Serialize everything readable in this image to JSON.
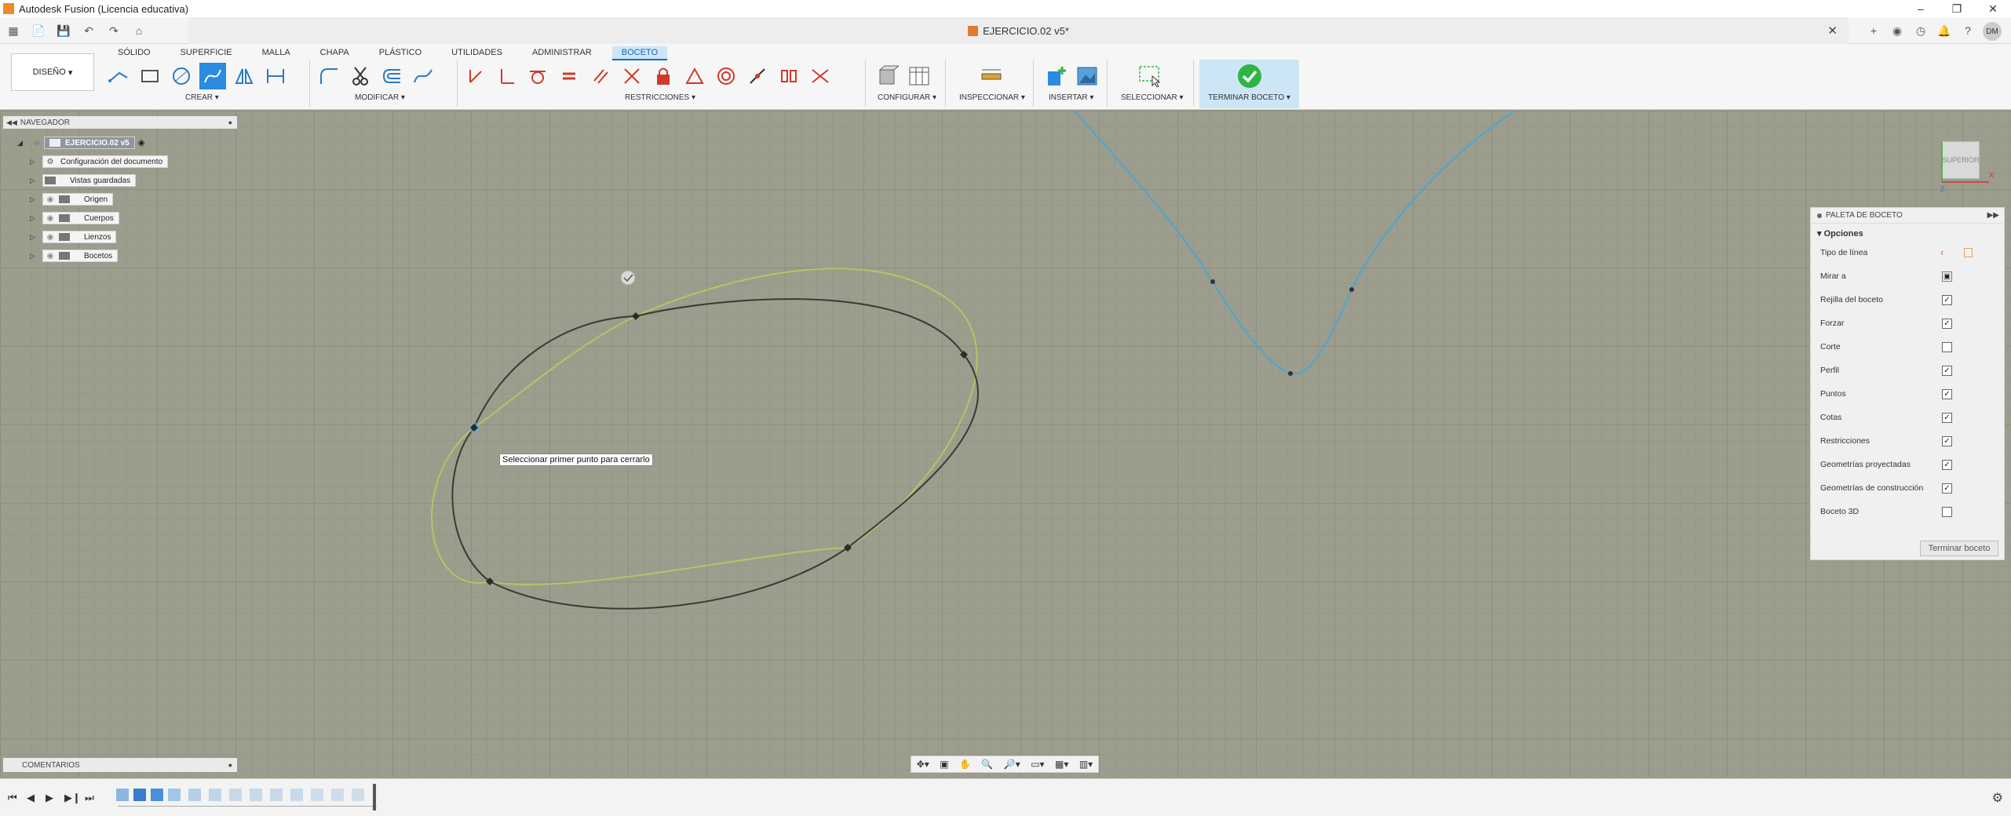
{
  "titlebar": {
    "title": "Autodesk Fusion (Licencia educativa)"
  },
  "document": {
    "name": "EJERCICIO.02 v5*"
  },
  "user": {
    "initials": "DM"
  },
  "workspace": {
    "label": "DISEÑO"
  },
  "tabs": [
    "SÓLIDO",
    "SUPERFICIE",
    "MALLA",
    "CHAPA",
    "PLÁSTICO",
    "UTILIDADES",
    "ADMINISTRAR",
    "BOCETO"
  ],
  "active_tab": "BOCETO",
  "groups": {
    "crear": "CREAR",
    "modificar": "MODIFICAR",
    "restricciones": "RESTRICCIONES",
    "configurar": "CONFIGURAR",
    "inspeccionar": "INSPECCIONAR",
    "insertar": "INSERTAR",
    "seleccionar": "SELECCIONAR",
    "terminar": "TERMINAR BOCETO"
  },
  "navigator": {
    "title": "NAVEGADOR",
    "root": "EJERCICIO.02 v5",
    "items": [
      "Configuración del documento",
      "Vistas guardadas",
      "Origen",
      "Cuerpos",
      "Lienzos",
      "Bocetos"
    ]
  },
  "palette": {
    "title": "PALETA DE BOCETO",
    "section": "Opciones",
    "rows": [
      {
        "label": "Tipo de línea",
        "control": "icons"
      },
      {
        "label": "Mirar a",
        "control": "button"
      },
      {
        "label": "Rejilla del boceto",
        "checked": true
      },
      {
        "label": "Forzar",
        "checked": true
      },
      {
        "label": "Corte",
        "checked": false
      },
      {
        "label": "Perfil",
        "checked": true
      },
      {
        "label": "Puntos",
        "checked": true
      },
      {
        "label": "Cotas",
        "checked": true
      },
      {
        "label": "Restricciones",
        "checked": true
      },
      {
        "label": "Geometrías proyectadas",
        "checked": true
      },
      {
        "label": "Geometrías de construcción",
        "checked": true
      },
      {
        "label": "Boceto 3D",
        "checked": false
      }
    ],
    "finish_button": "Terminar boceto"
  },
  "viewcube": {
    "label": "SUPERIOR"
  },
  "tooltip": {
    "text": "Seleccionar primer punto para cerrarlo"
  },
  "comments": {
    "title": "COMENTARIOS"
  },
  "colors": {
    "accent": "#0b6bc1",
    "finish_green": "#2fb543",
    "canvas": "#9c9d8c",
    "curve_blue": "#4aa6d4"
  }
}
